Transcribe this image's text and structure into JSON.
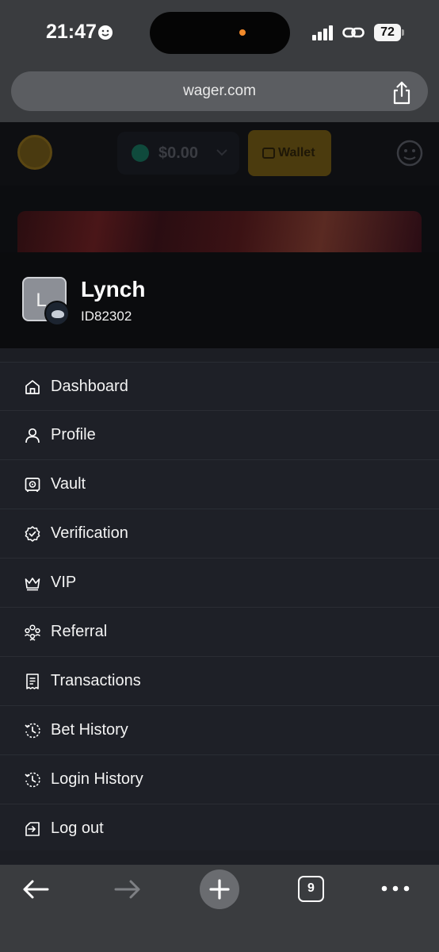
{
  "status_bar": {
    "time": "21:47",
    "battery": "72"
  },
  "browser": {
    "url": "wager.com",
    "tab_count": "9"
  },
  "site_header": {
    "balance": "$0.00",
    "wallet_label": "Wallet"
  },
  "profile": {
    "avatar_letter": "L",
    "name": "Lynch",
    "id": "ID82302"
  },
  "menu": {
    "items": [
      {
        "label": "Dashboard",
        "icon": "home-icon"
      },
      {
        "label": "Profile",
        "icon": "user-icon"
      },
      {
        "label": "Vault",
        "icon": "safe-icon"
      },
      {
        "label": "Verification",
        "icon": "verified-badge-icon"
      },
      {
        "label": "VIP",
        "icon": "crown-icon"
      },
      {
        "label": "Referral",
        "icon": "referral-group-icon"
      },
      {
        "label": "Transactions",
        "icon": "receipt-icon"
      },
      {
        "label": "Bet History",
        "icon": "history-icon"
      },
      {
        "label": "Login History",
        "icon": "history-icon"
      },
      {
        "label": "Log out",
        "icon": "logout-icon"
      }
    ]
  },
  "colors": {
    "menu_background": "#1e2027",
    "profile_background": "#0b0c0e",
    "browser_chrome": "#3a3c3f",
    "island_indicator": "#f28a2a"
  }
}
